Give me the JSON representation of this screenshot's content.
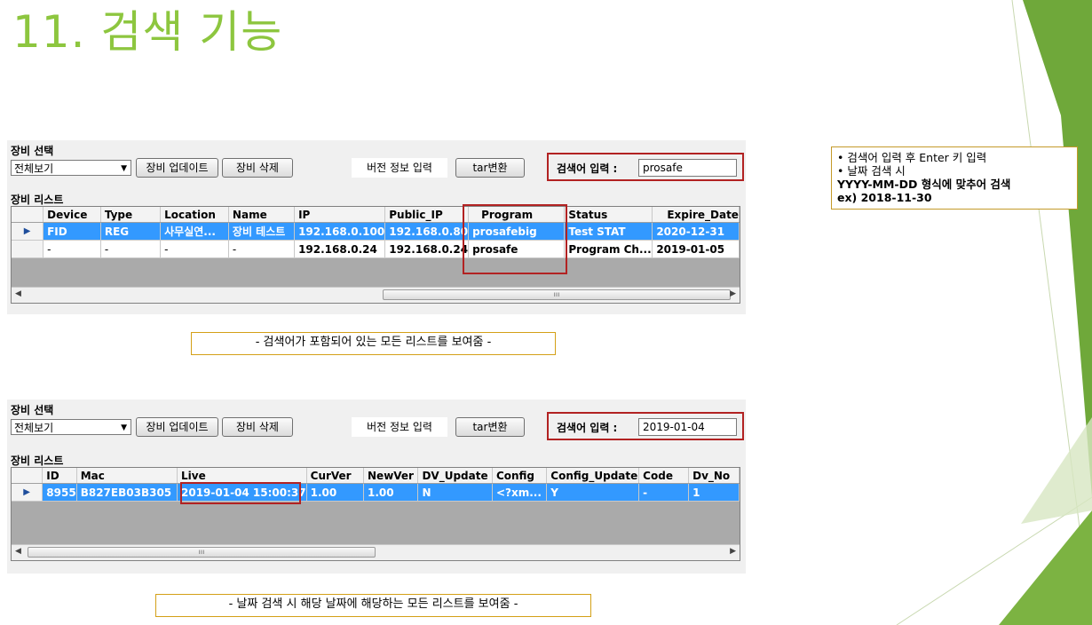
{
  "slide": {
    "title": "11. 검색 기능"
  },
  "top": {
    "equip_select_label": "장비 선택",
    "combo_value": "전체보기",
    "update_button": "장비 업데이트",
    "delete_button": "장비 삭제",
    "version_input": "버전 정보 입력",
    "tar_button": "tar변환",
    "search_label": "검색어 입력 :",
    "search_value": "prosafe",
    "list_label": "장비 리스트",
    "columns": [
      "Device",
      "Type",
      "Location",
      "Name",
      "IP",
      "Public_IP",
      "Program",
      "Status",
      "Expire_Date"
    ],
    "rows": [
      [
        "FID",
        "REG",
        "사무실연...",
        "장비 테스트",
        "192.168.0.100",
        "192.168.0.80",
        "prosafebig",
        "Test STAT",
        "2020-12-31"
      ],
      [
        "-",
        "-",
        "-",
        "-",
        "192.168.0.24",
        "192.168.0.24",
        "prosafe",
        "Program Ch...",
        "2019-01-05"
      ]
    ],
    "scroll_mark": "ııı"
  },
  "bottom": {
    "equip_select_label": "장비 선택",
    "combo_value": "전체보기",
    "update_button": "장비 업데이트",
    "delete_button": "장비 삭제",
    "version_input": "버전 정보 입력",
    "tar_button": "tar변환",
    "search_label": "검색어 입력 :",
    "search_value": "2019-01-04",
    "list_label": "장비 리스트",
    "columns": [
      "ID",
      "Mac",
      "Live",
      "CurVer",
      "NewVer",
      "DV_Update",
      "Config",
      "Config_Update",
      "Code",
      "Dv_No"
    ],
    "rows": [
      [
        "8955",
        "B827EB03B305",
        "2019-01-04 15:00:37",
        "1.00",
        "1.00",
        "N",
        "<?xm...",
        "Y",
        "-",
        "1"
      ]
    ],
    "scroll_mark": "ııı"
  },
  "captions": {
    "top": "- 검색어가 포함되어 있는 모든 리스트를 보여줌 -",
    "bottom": "- 날짜 검색 시 해당 날짜에 해당하는 모든 리스트를 보여줌 -"
  },
  "note": {
    "line1": "• 검색어 입력 후 Enter 키 입력",
    "line2": "• 날짜 검색 시",
    "line3": "YYYY-MM-DD 형식에 맞추어 검색",
    "line4": "ex) 2018-11-30"
  },
  "colors": {
    "title": "#8dc63f",
    "accent_green": "#6fa83a",
    "highlight": "#b22222",
    "selection": "#3399ff"
  }
}
